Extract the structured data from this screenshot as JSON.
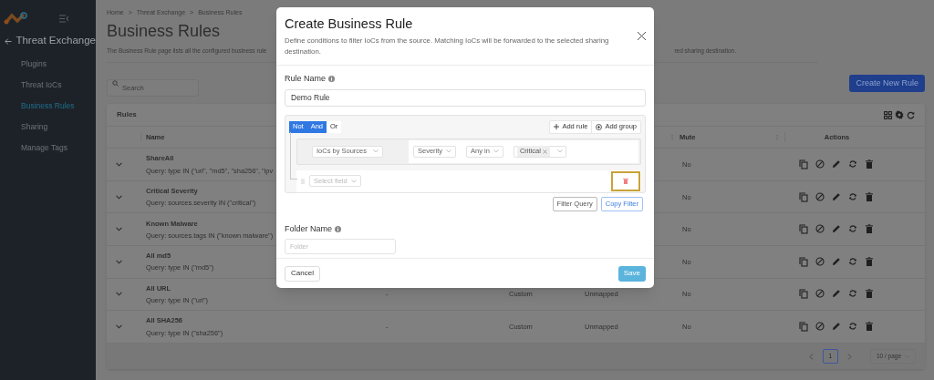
{
  "sidebar": {
    "section": "Threat Exchange",
    "items": [
      {
        "label": "Plugins",
        "selected": false
      },
      {
        "label": "Threat IoCs",
        "selected": false
      },
      {
        "label": "Business Rules",
        "selected": true
      },
      {
        "label": "Sharing",
        "selected": false
      },
      {
        "label": "Manage Tags",
        "selected": false
      }
    ]
  },
  "breadcrumb": [
    "Home",
    ">",
    "Threat Exchange",
    ">",
    "Business Rules"
  ],
  "page": {
    "title": "Business Rules",
    "description_start": "The Business Rule page lists all the configured business rule",
    "description_end": "red sharing destination.",
    "search": {
      "placeholder": "Search"
    },
    "create_button": "Create New Rule"
  },
  "table": {
    "title": "Rules",
    "columns": [
      {
        "label": "Name"
      },
      {
        "label": "Mute"
      },
      {
        "label": "Actions"
      }
    ],
    "rows": [
      {
        "name": "ShareAll",
        "query": "Query: type IN (\"url\", \"md5\", \"sha256\", \"ipv",
        "mute": "No"
      },
      {
        "name": "Critical Severity",
        "query": "Query: sources.severity IN (\"critical\")",
        "mute": "No"
      },
      {
        "name": "Known Malware",
        "query": "Query: sources.tags IN (\"known malware\")",
        "mute": "No"
      },
      {
        "name": "All md5",
        "query": "Query: type IN (\"md5\")",
        "mute": "No"
      },
      {
        "name": "All URL",
        "query": "Query: type IN (\"url\")",
        "column_2": "-",
        "column_3": "Custom",
        "column_4": "Unmapped",
        "mute": "No"
      },
      {
        "name": "All SHA256",
        "query": "Query: type IN (\"sha256\")",
        "column_2": "-",
        "column_3": "Custom",
        "column_4": "Unmapped",
        "mute": "No"
      }
    ],
    "pagination": {
      "page": "1",
      "page_size": "10 / page"
    }
  },
  "modal": {
    "title": "Create Business Rule",
    "description": "Define conditions to filter IoCs from the source. Matching IoCs will be forwarded to the selected sharing destination.",
    "rule_name": {
      "label": "Rule Name",
      "value": "Demo Rule"
    },
    "combinators": [
      {
        "label": "Not",
        "selected": true
      },
      {
        "label": "And",
        "selected": true
      },
      {
        "label": "Or",
        "selected": false
      }
    ],
    "add_rule": "Add rule",
    "add_group": "Add group",
    "rules": [
      {
        "kind": "condition",
        "source": "IoCs by Sources",
        "field": "Severity",
        "operator": "Any in",
        "values": [
          "Critical"
        ]
      },
      {
        "kind": "empty",
        "placeholder": "Select field"
      }
    ],
    "filter_query": "Filter Query",
    "copy_filter": "Copy Filter",
    "folder_name": {
      "label": "Folder Name",
      "placeholder": "Folder"
    },
    "cancel": "Cancel",
    "save": "Save"
  }
}
